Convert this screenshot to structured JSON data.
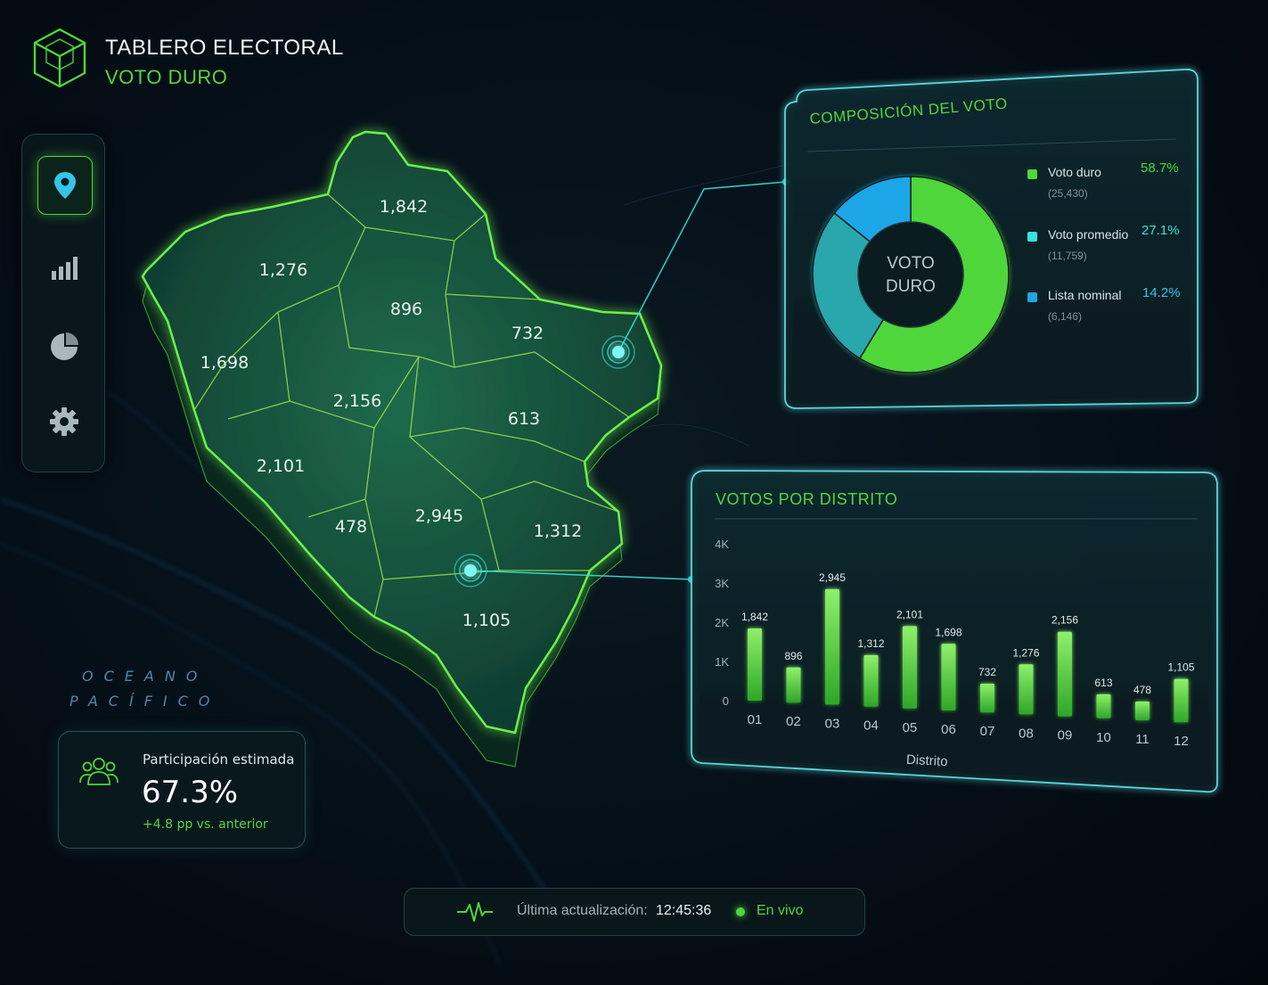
{
  "header": {
    "title": "TABLERO ELECTORAL",
    "subtitle": "VOTO DURO",
    "logo_icon": "cube-logo-icon"
  },
  "sidebar": {
    "items": [
      {
        "name": "map-pin-icon",
        "active": true
      },
      {
        "name": "bar-chart-icon",
        "active": false
      },
      {
        "name": "pie-chart-icon",
        "active": false
      },
      {
        "name": "gear-icon",
        "active": false
      }
    ]
  },
  "map": {
    "regions": [
      "1,842",
      "1,276",
      "896",
      "732",
      "1,698",
      "2,156",
      "613",
      "2,101",
      "478",
      "2,945",
      "1,312",
      "1,105"
    ],
    "ocean_line1": "OCEANO",
    "ocean_line2": "PACÍFICO"
  },
  "participation": {
    "label": "Participación estimada",
    "value": "67.3%",
    "delta": "+4.8 pp vs. anterior",
    "icon": "users-icon"
  },
  "composition": {
    "title": "COMPOSICIÓN DEL VOTO",
    "center_line1": "VOTO",
    "center_line2": "DURO",
    "legend": [
      {
        "label": "Voto duro",
        "count": "(25,430)",
        "pct": "58.7%",
        "color": "#4fd63a"
      },
      {
        "label": "Voto promedio",
        "count": "(11,759)",
        "pct": "27.1%",
        "color": "#2aa6ad"
      },
      {
        "label": "Lista nominal",
        "count": "(6,146)",
        "pct": "14.2%",
        "color": "#1fa6e8"
      }
    ]
  },
  "chart_data": {
    "type": "bar",
    "title": "VOTOS POR DISTRITO",
    "xlabel": "Distrito",
    "ylabel": "",
    "categories": [
      "01",
      "02",
      "03",
      "04",
      "05",
      "06",
      "07",
      "08",
      "09",
      "10",
      "11",
      "12"
    ],
    "values": [
      1842,
      896,
      2945,
      1312,
      2101,
      1698,
      732,
      1276,
      2156,
      613,
      478,
      1105
    ],
    "value_labels": [
      "1,842",
      "896",
      "2,945",
      "1,312",
      "2,101",
      "1,698",
      "732",
      "1,276",
      "2,156",
      "613",
      "478",
      "1,105"
    ],
    "yticks": [
      "4K",
      "3K",
      "2K",
      "1K",
      "0"
    ],
    "ylim": [
      0,
      4000
    ],
    "grid": false,
    "bar_color": "#4fd63a"
  },
  "status": {
    "label": "Última actualización:",
    "time": "12:45:36",
    "live": "En vivo",
    "icon": "pulse-icon"
  },
  "colors": {
    "accent_green": "#4fd63a",
    "accent_cyan": "#33e3e0",
    "accent_blue": "#1fa6e8"
  }
}
